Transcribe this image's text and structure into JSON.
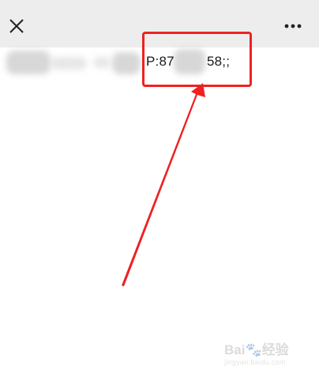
{
  "toolbar": {
    "close_icon": "close-icon",
    "more_icon": "more-dots-icon"
  },
  "content": {
    "visible_prefix": "P:87",
    "visible_suffix": "58;;"
  },
  "annotation": {
    "box_color": "#ee2222",
    "arrow_color": "#ee2222"
  },
  "watermark": {
    "brand": "Bai",
    "brand_suffix": "经验",
    "url": "jingyan.baidu.com"
  }
}
